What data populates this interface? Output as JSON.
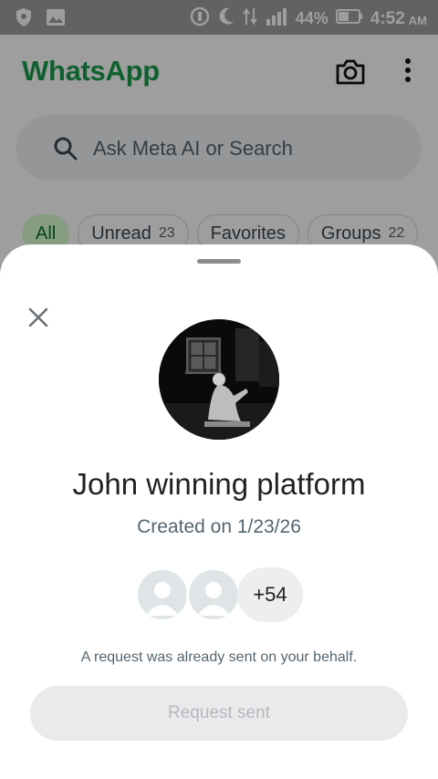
{
  "status_bar": {
    "battery": "44%",
    "time": "4:52",
    "ampm": "AM",
    "icons": [
      "shield-icon",
      "image-icon",
      "data-saver-icon",
      "moon-icon",
      "data-arrows-icon",
      "signal-icon",
      "battery-icon"
    ]
  },
  "header": {
    "brand": "WhatsApp",
    "brand_color": "#1a9c4c",
    "camera_icon": "camera-icon",
    "menu_icon": "more-vertical-icon"
  },
  "search": {
    "placeholder": "Ask Meta AI or Search"
  },
  "filters": [
    {
      "label": "All",
      "count": ""
    },
    {
      "label": "Unread",
      "count": "23"
    },
    {
      "label": "Favorites",
      "count": ""
    },
    {
      "label": "Groups",
      "count": "22"
    }
  ],
  "sheet": {
    "group_name": "John winning platform",
    "created": "Created on 1/23/26",
    "extra_members": "+54",
    "note": "A request was already sent on your behalf.",
    "button_label": "Request sent"
  }
}
